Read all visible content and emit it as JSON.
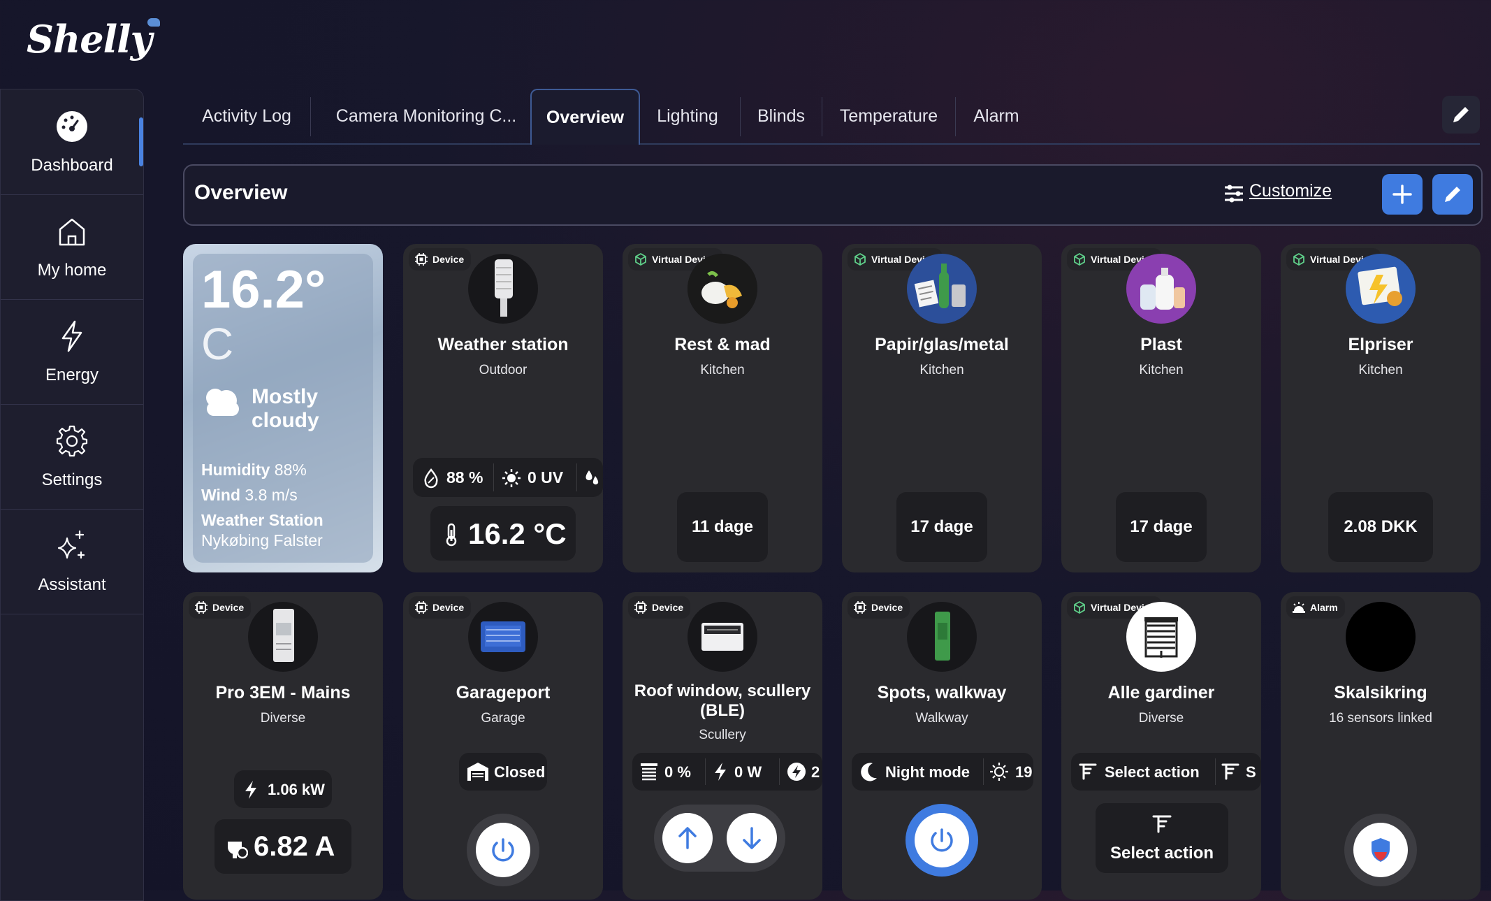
{
  "app": {
    "logo_text": "Shelly"
  },
  "sidebar": {
    "items": [
      {
        "label": "Dashboard",
        "icon": "dashboard-icon",
        "active": true
      },
      {
        "label": "My home",
        "icon": "home-icon"
      },
      {
        "label": "Energy",
        "icon": "lightning-icon"
      },
      {
        "label": "Settings",
        "icon": "gear-icon"
      },
      {
        "label": "Assistant",
        "icon": "sparkles-icon"
      }
    ]
  },
  "tabs": [
    {
      "label": "Activity Log"
    },
    {
      "label": "Camera Monitoring C..."
    },
    {
      "label": "Overview",
      "active": true
    },
    {
      "label": "Lighting"
    },
    {
      "label": "Blinds"
    },
    {
      "label": "Temperature"
    },
    {
      "label": "Alarm"
    }
  ],
  "overview": {
    "title": "Overview",
    "customize_label": "Customize"
  },
  "colors": {
    "accent": "#3f7be0",
    "card_bg": "#2a2a2e",
    "page_bg": "#17172b"
  },
  "weather": {
    "temp": "16.2°",
    "unit": "C",
    "condition_line1": "Mostly",
    "condition_line2": "cloudy",
    "humidity_label": "Humidity",
    "humidity_value": "88%",
    "wind_label": "Wind",
    "wind_value": "3.8 m/s",
    "station_label": "Weather Station",
    "station_location": "Nykøbing Falster"
  },
  "cards_row1": [
    {
      "badge": "Device",
      "title": "Weather station",
      "subtitle": "Outdoor",
      "humidity": "88 %",
      "uv": "0 UV",
      "temperature": "16.2 °C"
    },
    {
      "badge": "Virtual Device",
      "title": "Rest & mad",
      "subtitle": "Kitchen",
      "value": "11 dage"
    },
    {
      "badge": "Virtual Device",
      "title": "Papir/glas/metal",
      "subtitle": "Kitchen",
      "value": "17 dage"
    },
    {
      "badge": "Virtual Device",
      "title": "Plast",
      "subtitle": "Kitchen",
      "value": "17 dage"
    },
    {
      "badge": "Virtual Device",
      "title": "Elpriser",
      "subtitle": "Kitchen",
      "value": "2.08 DKK"
    }
  ],
  "cards_row2": [
    {
      "badge": "Device",
      "title": "Pro 3EM - Mains",
      "subtitle": "Diverse",
      "power": "1.06 kW",
      "current": "6.82 A"
    },
    {
      "badge": "Device",
      "title": "Garageport",
      "subtitle": "Garage",
      "status": "Closed"
    },
    {
      "badge": "Device",
      "title": "Roof window, scullery (BLE)",
      "subtitle": "Scullery",
      "position": "0 %",
      "power": "0 W",
      "extra": "2"
    },
    {
      "badge": "Device",
      "title": "Spots, walkway",
      "subtitle": "Walkway",
      "mode": "Night mode",
      "brightness": "19"
    },
    {
      "badge": "Virtual Device",
      "title": "Alle gardiner",
      "subtitle": "Diverse",
      "action_pill": "Select action",
      "action_pill2": "S",
      "action_button": "Select action"
    },
    {
      "badge": "Alarm",
      "title": "Skalsikring",
      "subtitle": "16 sensors linked"
    }
  ]
}
